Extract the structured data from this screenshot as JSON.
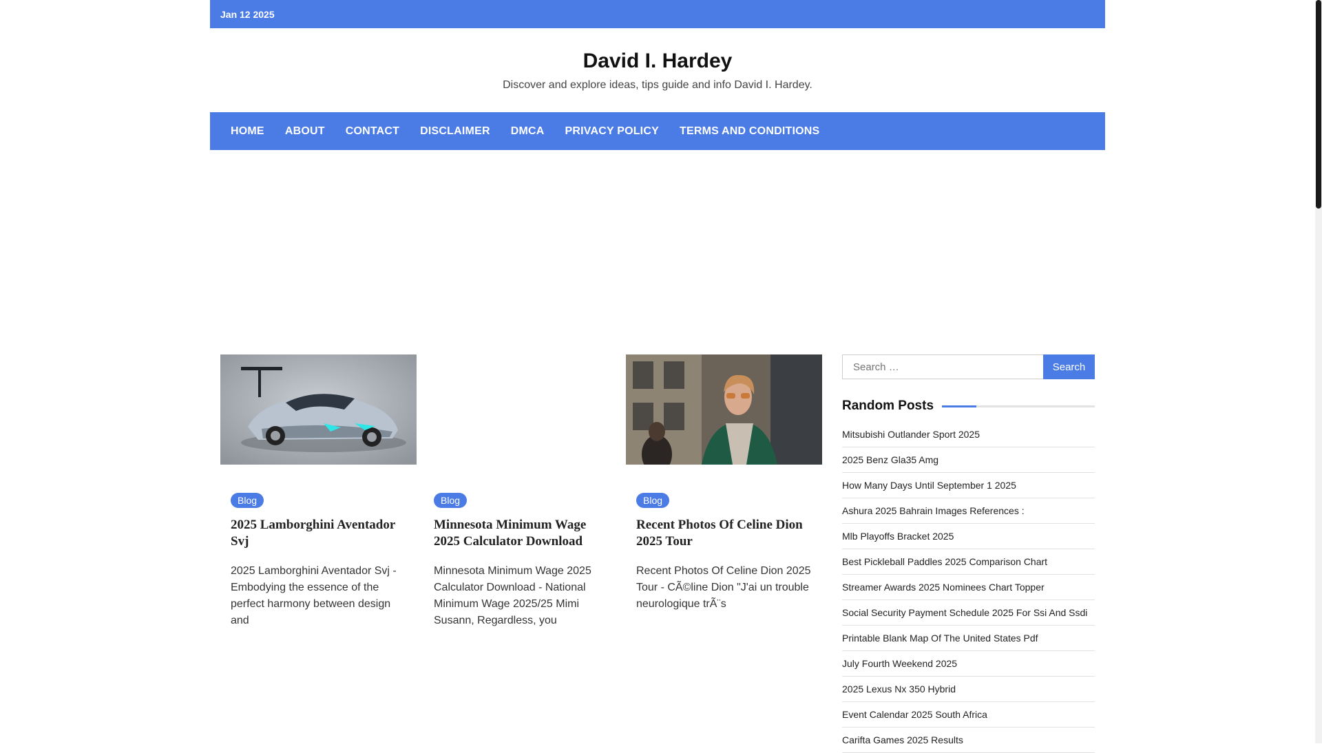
{
  "topbar": {
    "date": "Jan 12 2025"
  },
  "site": {
    "title": "David I. Hardey",
    "tagline": "Discover and explore ideas, tips guide and info David I. Hardey."
  },
  "nav": {
    "items": [
      {
        "label": "Home"
      },
      {
        "label": "About"
      },
      {
        "label": "Contact"
      },
      {
        "label": "Disclaimer"
      },
      {
        "label": "DMCA"
      },
      {
        "label": "Privacy Policy"
      },
      {
        "label": "Terms and Conditions"
      }
    ]
  },
  "posts": [
    {
      "category": "Blog",
      "title": "2025 Lamborghini Aventador Svj",
      "excerpt": "2025 Lamborghini Aventador Svj - Embodying the essence of the perfect harmony between design and",
      "image": "car-photo"
    },
    {
      "category": "Blog",
      "title": "Minnesota Minimum Wage 2025 Calculator Download",
      "excerpt": "Minnesota Minimum Wage 2025 Calculator Download - National Minimum Wage 2025/25 Mimi Susann, Regardless, you",
      "image": ""
    },
    {
      "category": "Blog",
      "title": "Recent Photos Of Celine Dion 2025 Tour",
      "excerpt": "Recent Photos Of Celine Dion 2025 Tour - CÃ©line Dion \"J'ai un trouble neurologique trÃ¨s",
      "image": "person-photo"
    }
  ],
  "sidebar": {
    "search": {
      "placeholder": "Search …",
      "button": "Search"
    },
    "random_posts": {
      "title": "Random Posts",
      "items": [
        "Mitsubishi Outlander Sport 2025",
        "2025 Benz Gla35 Amg",
        "How Many Days Until September 1 2025",
        "Ashura 2025 Bahrain Images References :",
        "Mlb Playoffs Bracket 2025",
        "Best Pickleball Paddles 2025 Comparison Chart",
        "Streamer Awards 2025 Nominees Chart Topper",
        "Social Security Payment Schedule 2025 For Ssi And Ssdi",
        "Printable Blank Map Of The United States Pdf",
        "July Fourth Weekend 2025",
        "2025 Lexus Nx 350 Hybrid",
        "Event Calendar 2025 South Africa",
        "Carifta Games 2025 Results"
      ]
    }
  },
  "colors": {
    "accent": "#4b7be5"
  }
}
